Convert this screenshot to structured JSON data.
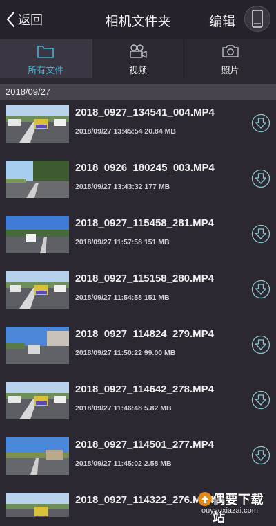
{
  "header": {
    "back_label": "返回",
    "title": "相机文件夹",
    "edit_label": "编辑"
  },
  "tabs": [
    {
      "label": "所有文件",
      "icon": "folder-icon",
      "active": true
    },
    {
      "label": "视频",
      "icon": "video-camera-icon",
      "active": false
    },
    {
      "label": "照片",
      "icon": "camera-icon",
      "active": false
    }
  ],
  "section": {
    "date": "2018/09/27"
  },
  "files": [
    {
      "name": "2018_0927_134541_004.MP4",
      "date": "2018/09/27 13:45:54",
      "size": "20.84 MB"
    },
    {
      "name": "2018_0926_180245_003.MP4",
      "date": "2018/09/27 13:43:32",
      "size": "177 MB"
    },
    {
      "name": "2018_0927_115458_281.MP4",
      "date": "2018/09/27 11:57:58",
      "size": "151 MB"
    },
    {
      "name": "2018_0927_115158_280.MP4",
      "date": "2018/09/27 11:54:58",
      "size": "151 MB"
    },
    {
      "name": "2018_0927_114824_279.MP4",
      "date": "2018/09/27 11:50:22",
      "size": "99.00 MB"
    },
    {
      "name": "2018_0927_114642_278.MP4",
      "date": "2018/09/27 11:46:48",
      "size": "5.82 MB"
    },
    {
      "name": "2018_0927_114501_277.MP4",
      "date": "2018/09/27 11:45:02",
      "size": "2.58 MB"
    },
    {
      "name": "2018_0927_114322_276.MP4",
      "date": "",
      "size": ""
    }
  ],
  "watermark": {
    "title": "偶要下载站",
    "url": "ouyaoxiazai.com"
  },
  "colors": {
    "accent": "#3fb3d6",
    "background": "#2b2832",
    "header": "#25222b",
    "active_tab": "#3a3742",
    "section": "#47444e"
  }
}
